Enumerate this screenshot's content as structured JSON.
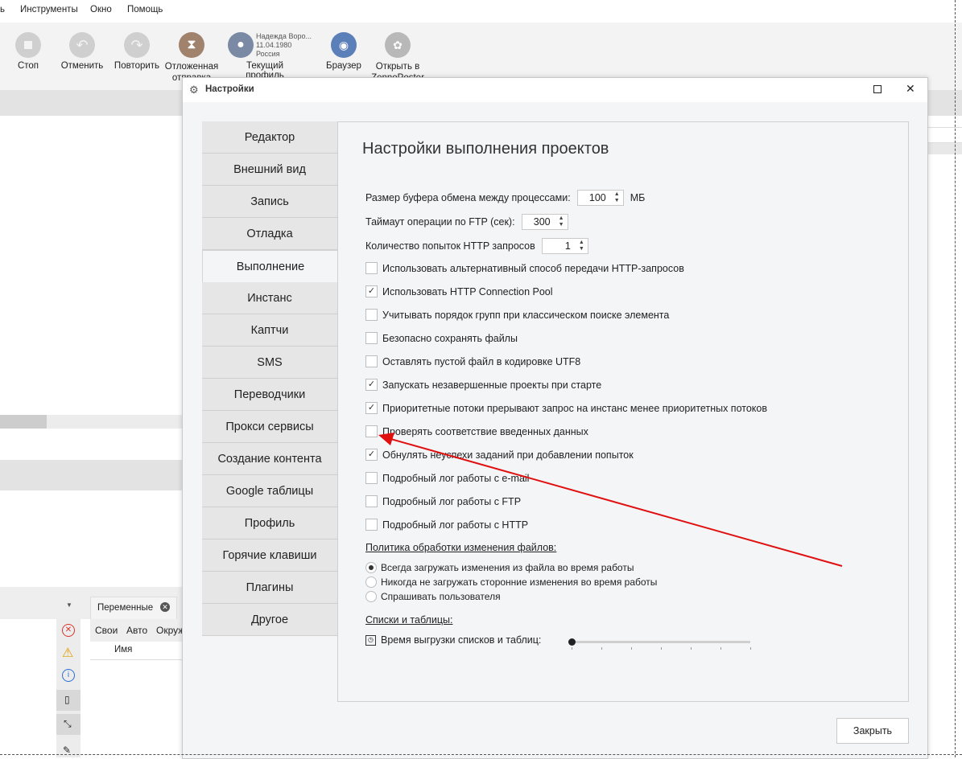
{
  "menu": [
    "ь",
    "Инструменты",
    "Окно",
    "Помощь"
  ],
  "toolbar": [
    {
      "label": "Стоп",
      "icon": "stop-icon",
      "color": "#c8c8c8"
    },
    {
      "label": "Отменить",
      "icon": "undo-icon",
      "color": "#c8c8c8"
    },
    {
      "label": "Повторить",
      "icon": "redo-icon",
      "color": "#c8c8c8"
    },
    {
      "label": "Отложенная отправка",
      "icon": "hourglass-icon",
      "color": "#a0826d"
    },
    {
      "label": "Текущий профиль",
      "icon": "user-icon",
      "color": "#7a8aa5"
    },
    {
      "label": "Браузер",
      "icon": "eye-icon",
      "color": "#5b7fb8"
    },
    {
      "label": "Открыть в ZennoPoster",
      "icon": "zennoposter-icon",
      "color": "#b0b0b0"
    }
  ],
  "profile": {
    "name": "Надежда Воро...",
    "date": "11.04.1980",
    "country": "Россия"
  },
  "bottom_tab": {
    "label": "Переменные",
    "subtabs": [
      "Свои",
      "Авто",
      "Окруж"
    ],
    "column": "Имя"
  },
  "dialog": {
    "title": "Настройки",
    "nav": [
      "Редактор",
      "Внешний вид",
      "Запись",
      "Отладка",
      "Выполнение",
      "Инстанс",
      "Каптчи",
      "SMS",
      "Переводчики",
      "Прокси сервисы",
      "Создание контента",
      "Google таблицы",
      "Профиль",
      "Горячие клавиши",
      "Плагины",
      "Другое"
    ],
    "active_nav": "Выполнение",
    "heading": "Настройки выполнения проектов",
    "buffer": {
      "label": "Размер буфера обмена между процессами:",
      "value": "100",
      "unit": "МБ"
    },
    "ftp_timeout": {
      "label": "Таймаут операции по FTP (сек):",
      "value": "300"
    },
    "http_retries": {
      "label": "Количество попыток HTTP запросов",
      "value": "1"
    },
    "checkboxes": [
      {
        "label": "Использовать альтернативный способ передачи HTTP-запросов",
        "checked": false
      },
      {
        "label": "Использовать HTTP Connection Pool",
        "checked": true
      },
      {
        "label": "Учитывать порядок групп при классическом поиске элемента",
        "checked": false
      },
      {
        "label": "Безопасно сохранять файлы",
        "checked": false
      },
      {
        "label": "Оставлять пустой файл в кодировке UTF8",
        "checked": false
      },
      {
        "label": "Запускать незавершенные проекты при старте",
        "checked": true
      },
      {
        "label": "Приоритетные потоки прерывают запрос на инстанс менее приоритетных потоков",
        "checked": true
      },
      {
        "label": "Проверять соответствие введенных данных",
        "checked": false
      },
      {
        "label": "Обнулять неуспехи заданий при добавлении попыток",
        "checked": true
      },
      {
        "label": "Подробный лог работы с e-mail",
        "checked": false
      },
      {
        "label": "Подробный лог работы с FTP",
        "checked": false
      },
      {
        "label": "Подробный лог работы с HTTP",
        "checked": false
      }
    ],
    "file_policy": {
      "title": "Политика обработки изменения файлов:",
      "options": [
        "Всегда загружать изменения из файла во время работы",
        "Никогда не загружать сторонние изменения во время работы",
        "Спрашивать пользователя"
      ],
      "selected": 0
    },
    "lists": {
      "title": "Списки и таблицы:",
      "slider_label": "Время выгрузки списков и таблиц:",
      "slider_value": 0
    },
    "close_label": "Закрыть"
  },
  "annotation_color": "#e01010"
}
